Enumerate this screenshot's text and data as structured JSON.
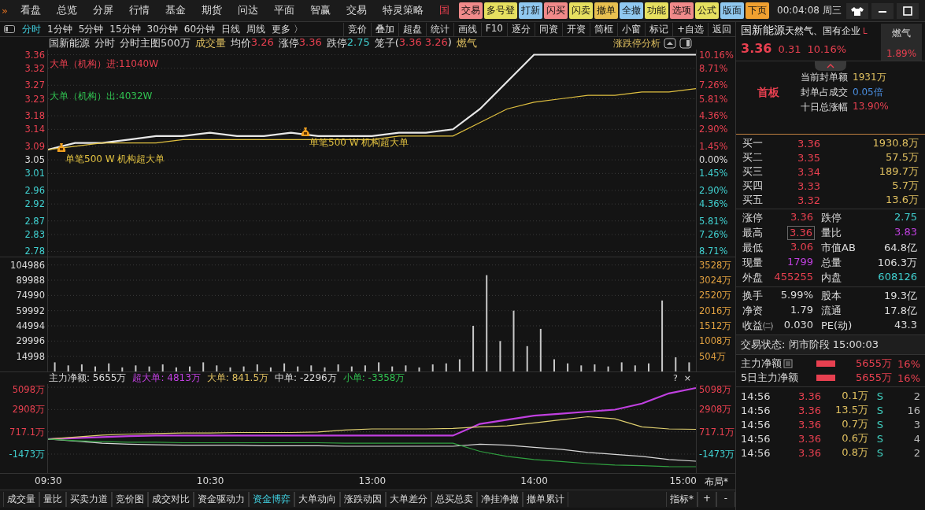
{
  "menu_bar": {
    "expand": "»",
    "items": [
      {
        "label": "看盘",
        "highlighted": false
      },
      {
        "label": "总览",
        "highlighted": false
      },
      {
        "label": "分屏",
        "highlighted": false
      },
      {
        "label": "行情",
        "highlighted": false
      },
      {
        "label": "基金",
        "highlighted": false
      },
      {
        "label": "期货",
        "highlighted": false
      },
      {
        "label": "问达",
        "highlighted": false
      },
      {
        "label": "平面",
        "highlighted": false
      },
      {
        "label": "智赢",
        "highlighted": false
      },
      {
        "label": "交易",
        "highlighted": false
      },
      {
        "label": "特灵策略",
        "highlighted": false
      },
      {
        "label": "国",
        "highlighted": true
      }
    ],
    "quick_buttons": [
      {
        "label": "交易",
        "color": "#f08a8a"
      },
      {
        "label": "多号登",
        "color": "#e6e060"
      },
      {
        "label": "打新",
        "color": "#90c8f0"
      },
      {
        "label": "闪买",
        "color": "#f08a8a"
      },
      {
        "label": "闪卖",
        "color": "#e6e060"
      },
      {
        "label": "撤单",
        "color": "#e8c050"
      },
      {
        "label": "全撤",
        "color": "#90c8f0"
      },
      {
        "label": "功能",
        "color": "#e6e060"
      },
      {
        "label": "选项",
        "color": "#f08a8a"
      },
      {
        "label": "公式",
        "color": "#e6e060"
      },
      {
        "label": "版面",
        "color": "#90c8f0"
      },
      {
        "label": "下页",
        "color": "#f0a030"
      }
    ],
    "clock": "00:04:08 周三"
  },
  "period_tabs": [
    {
      "label": "分时",
      "selected": true
    },
    {
      "label": "1分钟",
      "selected": false
    },
    {
      "label": "5分钟",
      "selected": false
    },
    {
      "label": "15分钟",
      "selected": false
    },
    {
      "label": "30分钟",
      "selected": false
    },
    {
      "label": "60分钟",
      "selected": false
    },
    {
      "label": "日线",
      "selected": false
    },
    {
      "label": "周线",
      "selected": false
    },
    {
      "label": "更多 〉",
      "selected": false
    }
  ],
  "tools": [
    "竞价",
    "叠加",
    "超盘",
    "统计",
    "画线",
    "F10",
    "逐分",
    "同资",
    "开资",
    "简框",
    "小窗",
    "标记",
    "+自选",
    "返回"
  ],
  "info_line": [
    {
      "parts": [
        {
          "text": "国新能源"
        }
      ]
    },
    {
      "parts": [
        {
          "text": "分时"
        }
      ]
    },
    {
      "parts": [
        {
          "text": "分时主图500万"
        }
      ]
    },
    {
      "parts": [
        {
          "text": "成交量",
          "color": "#e0c060"
        }
      ]
    },
    {
      "parts": [
        {
          "text": "均价"
        },
        {
          "text": "3.26",
          "color": "#e84050"
        }
      ]
    },
    {
      "parts": [
        {
          "text": "涨停"
        },
        {
          "text": "3.36",
          "color": "#e84050"
        }
      ]
    },
    {
      "parts": [
        {
          "text": "跌停"
        },
        {
          "text": "2.75",
          "color": "#40d0d0"
        }
      ]
    },
    {
      "parts": [
        {
          "text": "笼子("
        },
        {
          "text": "3.36 3.26",
          "color": "#e84050"
        },
        {
          "text": ")"
        }
      ]
    },
    {
      "parts": [
        {
          "text": "燃气",
          "color": "#e0c060"
        }
      ]
    }
  ],
  "analysis_button": "涨跌停分析",
  "price_panel": {
    "legend": [
      {
        "text": "大单（机构）进:11040W",
        "color": "#e84050"
      },
      {
        "text": "大单（机构）出:4032W",
        "color": "#30c050"
      }
    ],
    "notes": [
      "单笔500 W 机构超大单",
      "单笔500 W 机构超大单"
    ],
    "right_ticks": [
      {
        "label": "10.16%",
        "color": "#e84050"
      },
      {
        "label": "8.71%",
        "color": "#e84050"
      },
      {
        "label": "7.26%",
        "color": "#e84050"
      },
      {
        "label": "5.81%",
        "color": "#e84050"
      },
      {
        "label": "4.36%",
        "color": "#e84050"
      },
      {
        "label": "2.90%",
        "color": "#e84050"
      },
      {
        "label": "1.45%",
        "color": "#e84050"
      },
      {
        "label": "0.00%",
        "color": "#dcdcdc"
      },
      {
        "label": "1.45%",
        "color": "#40d0d0"
      },
      {
        "label": "2.90%",
        "color": "#40d0d0"
      },
      {
        "label": "4.36%",
        "color": "#40d0d0"
      },
      {
        "label": "5.81%",
        "color": "#40d0d0"
      },
      {
        "label": "7.26%",
        "color": "#40d0d0"
      },
      {
        "label": "8.71%",
        "color": "#40d0d0"
      }
    ],
    "chart_data": {
      "type": "line",
      "grid": true,
      "categories": [
        null,
        null,
        null,
        null,
        null,
        null,
        null,
        null,
        null,
        null,
        null,
        null,
        null,
        null,
        null,
        null,
        null,
        null,
        null,
        null,
        null,
        null,
        null,
        null,
        null
      ],
      "ylim": [
        2.765,
        3.375
      ],
      "yticks": [
        3.36,
        3.32,
        3.27,
        3.23,
        3.18,
        3.14,
        3.09,
        3.05,
        3.01,
        2.96,
        2.92,
        2.87,
        2.83,
        2.78
      ],
      "series": [
        {
          "color": "#e8e8e8",
          "values": [
            3.08,
            3.1,
            3.1,
            3.11,
            3.12,
            3.12,
            3.13,
            3.12,
            3.12,
            3.13,
            3.12,
            3.12,
            3.12,
            3.13,
            3.13,
            3.14,
            3.2,
            3.28,
            3.36,
            3.36,
            3.36,
            3.36,
            3.36,
            3.36,
            3.36
          ]
        },
        {
          "color": "#e0c040",
          "values": [
            3.08,
            3.09,
            3.1,
            3.1,
            3.1,
            3.11,
            3.11,
            3.11,
            3.11,
            3.11,
            3.11,
            3.11,
            3.11,
            3.12,
            3.12,
            3.12,
            3.16,
            3.2,
            3.22,
            3.23,
            3.24,
            3.24,
            3.25,
            3.25,
            3.26
          ]
        }
      ]
    }
  },
  "volume_panel": {
    "right_ticks": [
      "3528万",
      "3024万",
      "2520万",
      "2016万",
      "1512万",
      "1008万",
      "504万"
    ],
    "chart_data": {
      "type": "bar",
      "grid": true,
      "categories": [
        null,
        null,
        null,
        null,
        null,
        null,
        null,
        null,
        null,
        null,
        null,
        null,
        null,
        null,
        null,
        null,
        null,
        null,
        null,
        null,
        null,
        null,
        null,
        null,
        null,
        null,
        null,
        null,
        null,
        null,
        null,
        null,
        null,
        null,
        null,
        null,
        null,
        null,
        null,
        null,
        null,
        null,
        null,
        null,
        null,
        null,
        null,
        null
      ],
      "ylim": [
        0,
        112500
      ],
      "yticks": [
        104986,
        89988,
        74990,
        59992,
        44994,
        29996,
        14998
      ],
      "series": [
        {
          "color": "#c8c8c8",
          "values": [
            9000,
            6000,
            7000,
            5000,
            8000,
            4000,
            6000,
            5000,
            7000,
            4000,
            5000,
            9000,
            6000,
            4000,
            5000,
            7000,
            4000,
            8000,
            5000,
            6000,
            4000,
            7000,
            5000,
            6000,
            9000,
            5000,
            6000,
            4000,
            7000,
            8000,
            12000,
            45000,
            95000,
            30000,
            60000,
            25000,
            42000,
            12000,
            8000,
            6000,
            7000,
            5000,
            9000,
            6000,
            8000,
            70000,
            14000,
            9000
          ]
        }
      ]
    }
  },
  "flow_legend": [
    {
      "text": "主力净额: 5655万",
      "color": "#dcdcdc"
    },
    {
      "text": "超大单: 4813万",
      "color": "#c040e0"
    },
    {
      "text": "大单: 841.5万",
      "color": "#e0c060"
    },
    {
      "text": "中单: -2296万",
      "color": "#dcdcdc"
    },
    {
      "text": "小单: -3358万",
      "color": "#30c050"
    }
  ],
  "flow_help": "?",
  "flow_close": "×",
  "flow_panel": {
    "right_ticks": [
      {
        "label": "5098万",
        "color": "#e84050"
      },
      {
        "label": "2908万",
        "color": "#e84050"
      },
      {
        "label": "717.1万",
        "color": "#e84050"
      },
      {
        "label": "-1473万",
        "color": "#40d0d0"
      }
    ],
    "chart_data": {
      "type": "line",
      "grid": true,
      "categories": [
        null,
        null,
        null,
        null,
        null,
        null,
        null,
        null,
        null,
        null,
        null,
        null,
        null,
        null,
        null,
        null,
        null,
        null,
        null,
        null,
        null,
        null,
        null,
        null,
        null
      ],
      "ylim": [
        -3330,
        5410
      ],
      "yticks": [
        {
          "value": 5098,
          "label": "5098万"
        },
        {
          "value": 2908,
          "label": "2908万"
        },
        {
          "value": 717.1,
          "label": "717.1万"
        },
        {
          "value": -1473,
          "label": "-1473万"
        }
      ],
      "series": [
        {
          "color": "#c040e0",
          "values": [
            0,
            100,
            200,
            300,
            350,
            350,
            350,
            350,
            350,
            350,
            350,
            350,
            350,
            350,
            350,
            350,
            1500,
            1900,
            2300,
            2500,
            2700,
            2900,
            3500,
            4500,
            5020
          ]
        },
        {
          "color": "#e0d070",
          "values": [
            0,
            200,
            400,
            500,
            550,
            600,
            600,
            650,
            650,
            650,
            700,
            900,
            1000,
            1000,
            1000,
            1050,
            1200,
            1300,
            1600,
            1900,
            2200,
            2000,
            1200,
            1000,
            960
          ]
        },
        {
          "color": "#d8d8d8",
          "values": [
            0,
            -200,
            -400,
            -500,
            -550,
            -600,
            -600,
            -600,
            -650,
            -650,
            -650,
            -700,
            -700,
            -700,
            -700,
            -700,
            -500,
            -600,
            -800,
            -1000,
            -1300,
            -1500,
            -1700,
            -2000,
            -2170
          ]
        },
        {
          "color": "#30a040",
          "values": [
            0,
            -150,
            -250,
            -300,
            -300,
            -350,
            -350,
            -350,
            -350,
            -350,
            -350,
            -400,
            -400,
            -400,
            -400,
            -400,
            -1200,
            -1700,
            -2000,
            -2200,
            -2400,
            -2550,
            -2600,
            -2700,
            -2710
          ]
        }
      ]
    }
  },
  "time_axis": [
    "09:30",
    "10:30",
    "13:00",
    "14:00",
    "15:00"
  ],
  "layout_button": "布局*",
  "bottom_tabs": [
    {
      "label": "成交量",
      "selected": false
    },
    {
      "label": "量比",
      "selected": false
    },
    {
      "label": "买卖力道",
      "selected": false
    },
    {
      "label": "竞价图",
      "selected": false
    },
    {
      "label": "成交对比",
      "selected": false
    },
    {
      "label": "资金驱动力",
      "selected": false
    },
    {
      "label": "资金博弈",
      "selected": true
    },
    {
      "label": "大单动向",
      "selected": false
    },
    {
      "label": "涨跌动因",
      "selected": false
    },
    {
      "label": "大单差分",
      "selected": false
    },
    {
      "label": "总买总卖",
      "selected": false
    },
    {
      "label": "净挂净撤",
      "selected": false
    },
    {
      "label": "撤单累计",
      "selected": false
    }
  ],
  "indicator_button": "指标*",
  "zoom_buttons": [
    "+",
    "-"
  ],
  "quote": {
    "name": "国新能源",
    "tags": "天然气、国有企业",
    "flag": "L",
    "sector": {
      "name": "燃气",
      "change": "1.89%"
    },
    "price": "3.36",
    "change": "0.31",
    "change_pct": "10.16%",
    "board": "首板",
    "limit_info": [
      {
        "label": "当前封单额",
        "value": "1931万",
        "color": "#e0c060"
      },
      {
        "label": "封单占成交",
        "value": "0.05倍",
        "color": "#4a8ee0"
      },
      {
        "label": "十日总涨幅",
        "value": "13.90%",
        "color": "#e84050"
      }
    ],
    "bids": [
      {
        "label": "买一",
        "price": "3.36",
        "volume": "1930.8万"
      },
      {
        "label": "买二",
        "price": "3.35",
        "volume": "57.5万"
      },
      {
        "label": "买三",
        "price": "3.34",
        "volume": "189.7万"
      },
      {
        "label": "买四",
        "price": "3.33",
        "volume": "5.7万"
      },
      {
        "label": "买五",
        "price": "3.32",
        "volume": "13.6万"
      }
    ],
    "stats": [
      {
        "label": "涨停",
        "value": "3.36",
        "color": "#e84050",
        "boxed": false
      },
      {
        "label": "跌停",
        "value": "2.75",
        "color": "#40d0d0",
        "boxed": false
      },
      {
        "label": "最高",
        "value": "3.36",
        "color": "#e84050",
        "boxed": true
      },
      {
        "label": "量比",
        "value": "3.83",
        "color": "#c040e0",
        "boxed": false
      },
      {
        "label": "最低",
        "value": "3.06",
        "color": "#e84050",
        "boxed": false
      },
      {
        "label": "市值AB",
        "value": "64.8亿",
        "color": "#dcdcdc",
        "boxed": false
      },
      {
        "label": "现量",
        "value": "1799",
        "color": "#c040e0",
        "boxed": false
      },
      {
        "label": "总量",
        "value": "106.3万",
        "color": "#dcdcdc",
        "boxed": false
      },
      {
        "label": "外盘",
        "value": "455255",
        "color": "#e84050",
        "boxed": false
      },
      {
        "label": "内盘",
        "value": "608126",
        "color": "#40d0d0",
        "boxed": false
      }
    ],
    "fundamentals": [
      {
        "label": "换手",
        "value": "5.99%"
      },
      {
        "label": "股本",
        "value": "19.3亿"
      },
      {
        "label": "净资",
        "value": "1.79"
      },
      {
        "label": "流通",
        "value": "17.8亿"
      },
      {
        "label": "收益㈡",
        "value": "0.030"
      },
      {
        "label": "PE(动)",
        "value": "43.3"
      }
    ],
    "trade_status": "交易状态: 闭市阶段 15:00:03",
    "main_flow": [
      {
        "label": "主力净额",
        "value": "5655万",
        "pct": "16%"
      },
      {
        "label": "5日主力净额",
        "value": "5655万",
        "pct": "16%"
      }
    ],
    "ticks": [
      {
        "time": "14:56",
        "price": "3.36",
        "volume": "0.1万",
        "side": "S",
        "count": "2"
      },
      {
        "time": "14:56",
        "price": "3.36",
        "volume": "13.5万",
        "side": "S",
        "count": "16"
      },
      {
        "time": "14:56",
        "price": "3.36",
        "volume": "0.7万",
        "side": "S",
        "count": "3"
      },
      {
        "time": "14:56",
        "price": "3.36",
        "volume": "0.6万",
        "side": "S",
        "count": "4"
      },
      {
        "time": "14:56",
        "price": "3.36",
        "volume": "0.8万",
        "side": "S",
        "count": "2"
      }
    ]
  }
}
